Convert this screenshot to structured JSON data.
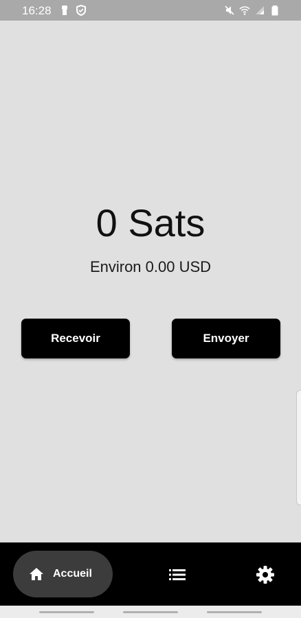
{
  "status_bar": {
    "time": "16:28",
    "left_icons": [
      "person-icon",
      "shield-icon"
    ],
    "right_icons": [
      "mute-icon",
      "wifi-icon",
      "signal-icon",
      "battery-icon"
    ]
  },
  "wallet": {
    "balance": "0 Sats",
    "approx": "Environ 0.00 USD"
  },
  "actions": {
    "receive_label": "Recevoir",
    "send_label": "Envoyer"
  },
  "bottom_nav": {
    "home_label": "Accueil",
    "home_icon": "home-icon",
    "list_icon": "list-icon",
    "settings_icon": "gear-icon"
  }
}
